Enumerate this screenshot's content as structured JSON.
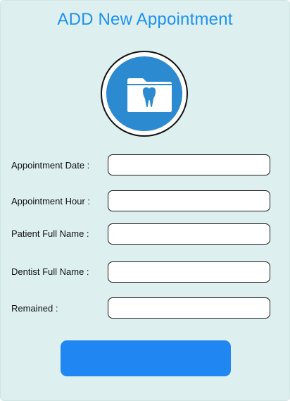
{
  "form": {
    "title": "ADD New Appointment",
    "logo_icon": "dental-folder-icon",
    "fields": [
      {
        "label": "Appointment Date :",
        "value": ""
      },
      {
        "label": "Appointment Hour :",
        "value": ""
      },
      {
        "label": "Patient Full Name :",
        "value": ""
      },
      {
        "label": "Dentist Full Name :",
        "value": ""
      },
      {
        "label": "Remained :",
        "value": ""
      }
    ],
    "submit_label": ""
  },
  "colors": {
    "background": "#ddf0ef",
    "title": "#1e90f0",
    "logo_circle": "#2b8ad0",
    "button": "#1f86f2"
  }
}
